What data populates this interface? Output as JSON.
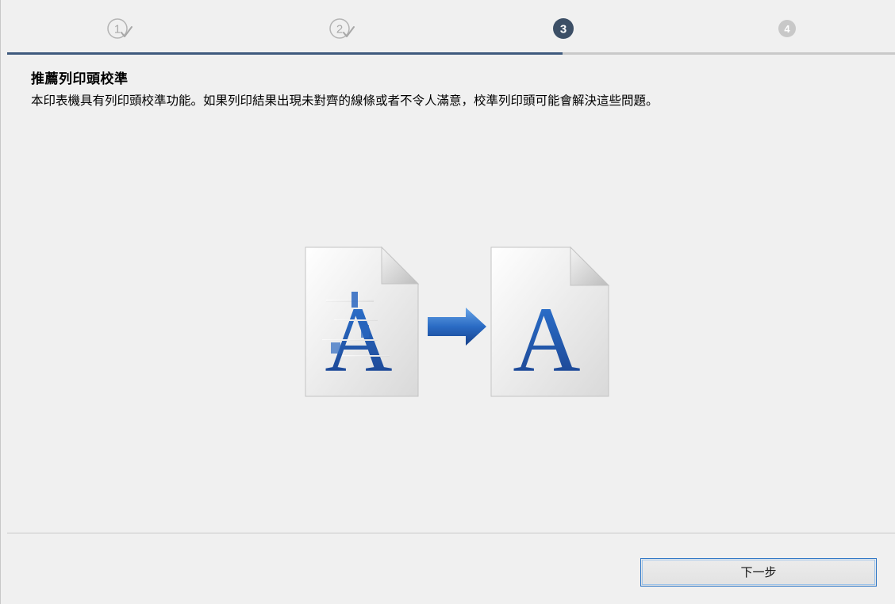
{
  "wizard": {
    "steps": [
      {
        "number": "1",
        "state": "completed"
      },
      {
        "number": "2",
        "state": "completed"
      },
      {
        "number": "3",
        "state": "current"
      },
      {
        "number": "4",
        "state": "upcoming"
      }
    ],
    "current_step": 3,
    "total_steps": 4
  },
  "content": {
    "title": "推薦列印頭校準",
    "description": "本印表機具有列印頭校準功能。如果列印結果出現未對齊的線條或者不令人滿意，校準列印頭可能會解決這些問題。",
    "illustration": {
      "before_glyph": "A",
      "after_glyph": "A"
    }
  },
  "footer": {
    "next_label": "下一步"
  },
  "colors": {
    "background": "#f0f0f0",
    "step_completed": "#b4b4b4",
    "step_current": "#3c4f66",
    "step_upcoming": "#c8c8c8",
    "progress_fill": "#3f5a7e",
    "glyph_blue": "#1f5aa8",
    "button_border": "#2f76c5"
  },
  "icons": {
    "completed_step": "check-circle-icon",
    "current_step": "filled-circle-number-icon",
    "upcoming_step": "filled-circle-number-icon"
  }
}
